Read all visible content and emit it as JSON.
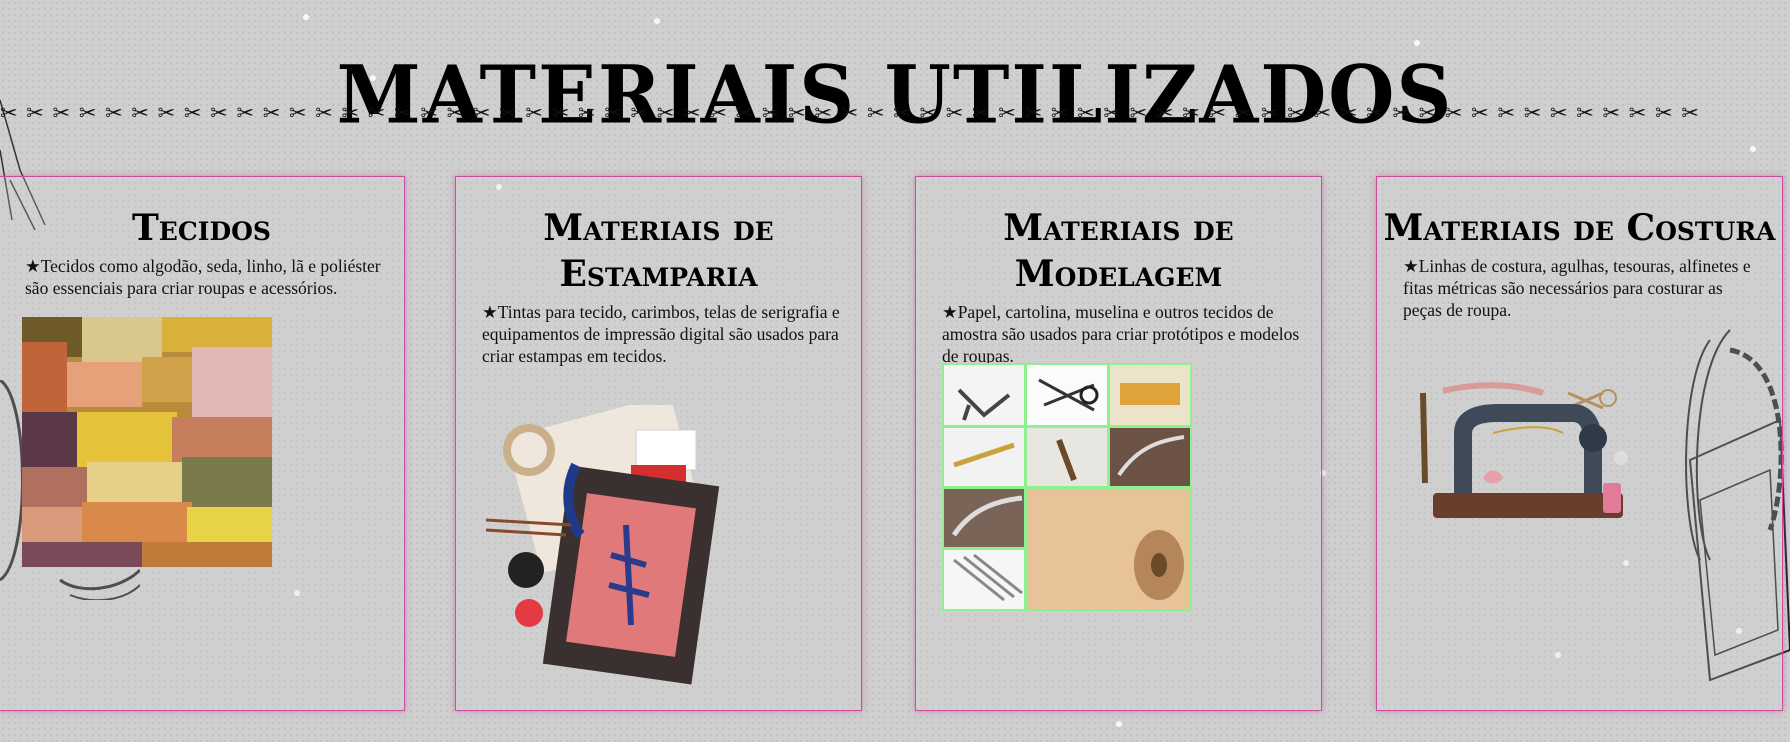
{
  "page": {
    "title": "MATERIAIS UTILIZADOS"
  },
  "divider": {
    "text": "✂ ✂ ✂ ✂ ✂ ✂ ✂ ✂ ✂ ✂ ✂ ✂ ✂ ✂ ✂ ✂ ✂ ✂ ✂ ✂ ✂ ✂ ✂ ✂ ✂ ✂ ✂ ✂ ✂ ✂ ✂ ✂ ✂ ✂ ✂ ✂ ✂ ✂ ✂ ✂ ✂ ✂ ✂ ✂ ✂ ✂ ✂ ✂ ✂ ✂ ✂ ✂ ✂ ✂ ✂ ✂ ✂ ✂ ✂ ✂ ✂ ✂ ✂ ✂ ✂ ✂ ✂ ✂ ✂ ✂ ✂ ✂"
  },
  "cards": [
    {
      "title": "Tecidos",
      "text": "★Tecidos como algodão, seda, linho, lã e poliéster são essenciais para criar roupas e acessórios."
    },
    {
      "title": "Materiais de Estamparia",
      "text": "★Tintas para tecido, carimbos, telas de serigrafia e equipamentos de impressão digital são usados para criar estampas em tecidos."
    },
    {
      "title": "Materiais de Modelagem",
      "text": "★Papel, cartolina, muselina e outros tecidos de amostra são usados para criar protótipos e modelos de roupas."
    },
    {
      "title": "Materiais de Costura",
      "text": "★Linhas de costura, agulhas, tesouras, alfinetes e fitas métricas são necessários para costurar as peças de roupa."
    }
  ],
  "colors": {
    "card_border": "#c84fa0",
    "grid_border": "#8ff08f"
  }
}
